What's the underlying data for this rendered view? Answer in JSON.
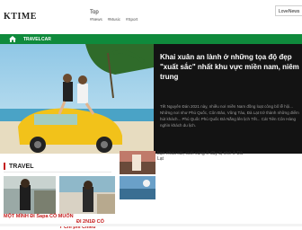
{
  "header": {
    "logo": "KTIME",
    "top_label": "Top",
    "tags": [
      "#News",
      "#Music",
      "#Sport"
    ],
    "account": "LoveNews"
  },
  "nav": {
    "items": [
      "TRAVEL",
      "CAR"
    ]
  },
  "hero": {
    "title": "Khai xuân an lành ở những tọa độ đẹp \"xuất sắc\" nhất khu vực miền nam, niêm trung",
    "excerpt": "Tết Nguyên Đán 2021 này, nhiều nơi miền Nam đồng loạt công bố lễ hội... Những nơi như Phú Quốc, Côn Đảo, Vũng Tàu, Đà Lạt trở thành những điểm hút khách... Phú Quốc Phú Quốc Đà Nẵng lên lịch Tết... Cát Tiên Côn Hàng nghìn khách du lịch."
  },
  "travel": {
    "heading": "TRAVEL",
    "captions": [
      "MỘT MÌNH ĐI Sapa CÓ MUỐN",
      "ĐI 2N1Đ CÓ",
      "T Chỉ phí Chiếu"
    ],
    "side_items": [
      "bạn nhau sài, cuối cùng ở đây bị nhớ ở Đà Lạt",
      ""
    ]
  }
}
